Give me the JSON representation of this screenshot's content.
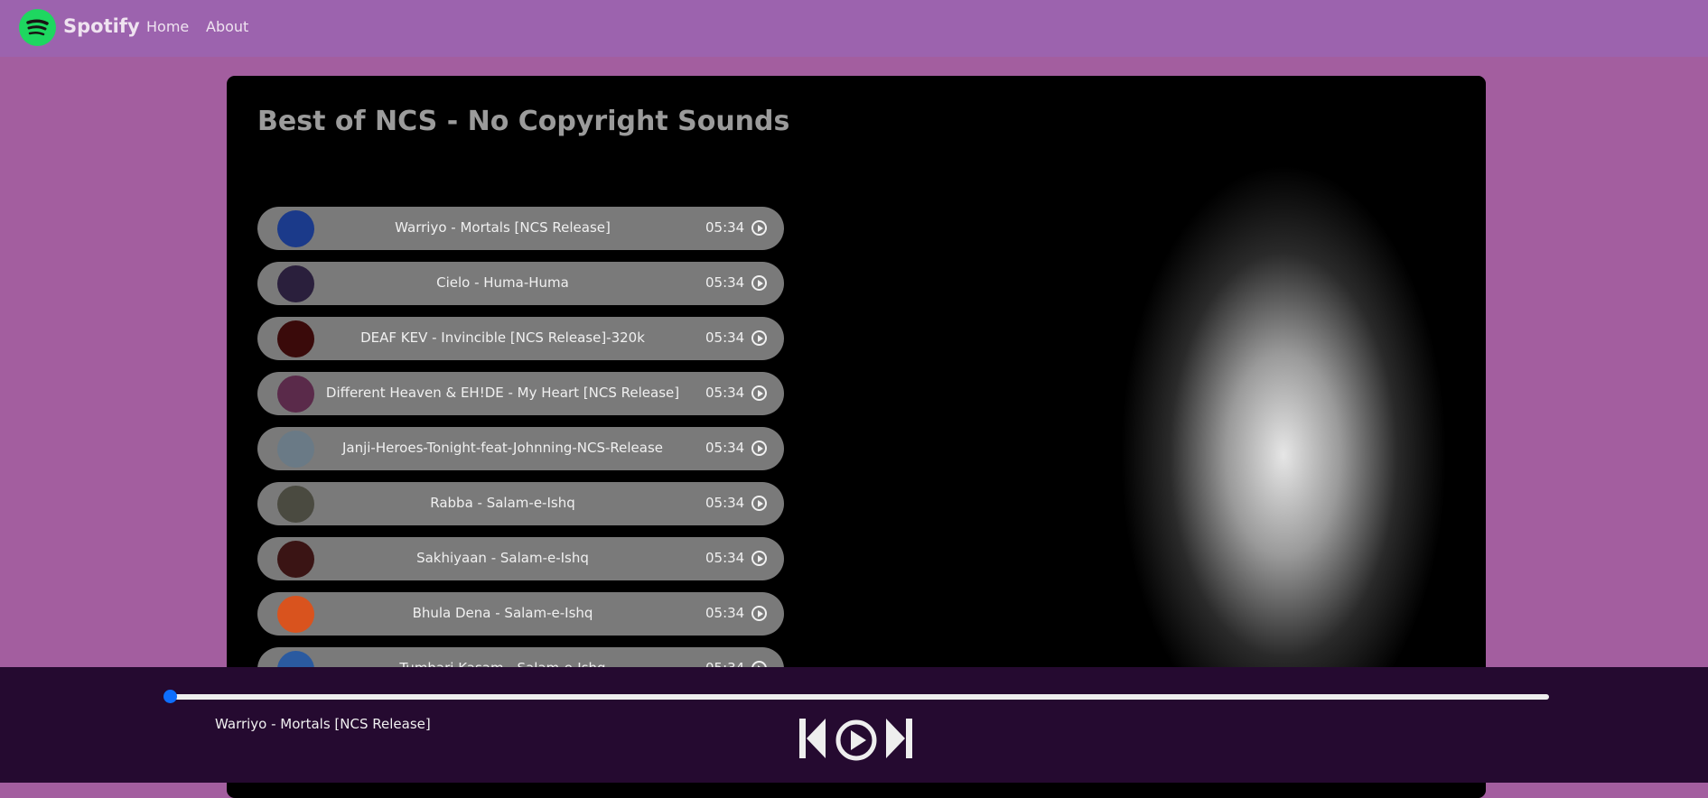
{
  "nav": {
    "brand": "Spotify",
    "links": [
      "Home",
      "About"
    ]
  },
  "playlist": {
    "title": "Best of NCS - No Copyright Sounds",
    "songs": [
      {
        "name": "Warriyo - Mortals [NCS Release]",
        "duration": "05:34",
        "thumb_color": "#1b3a8a"
      },
      {
        "name": "Cielo - Huma-Huma",
        "duration": "05:34",
        "thumb_color": "#2a1f3c"
      },
      {
        "name": "DEAF KEV - Invincible [NCS Release]-320k",
        "duration": "05:34",
        "thumb_color": "#3a0a0a"
      },
      {
        "name": "Different Heaven & EH!DE - My Heart [NCS Release]",
        "duration": "05:34",
        "thumb_color": "#5a2a4a"
      },
      {
        "name": "Janji-Heroes-Tonight-feat-Johnning-NCS-Release",
        "duration": "05:34",
        "thumb_color": "#6a7a86"
      },
      {
        "name": "Rabba - Salam-e-Ishq",
        "duration": "05:34",
        "thumb_color": "#4a4a40"
      },
      {
        "name": "Sakhiyaan - Salam-e-Ishq",
        "duration": "05:34",
        "thumb_color": "#3a1414"
      },
      {
        "name": "Bhula Dena - Salam-e-Ishq",
        "duration": "05:34",
        "thumb_color": "#d9531e"
      },
      {
        "name": "Tumhari Kasam - Salam-e-Ishq",
        "duration": "05:34",
        "thumb_color": "#2a5aa0"
      }
    ]
  },
  "player": {
    "now_playing": "Warriyo - Mortals [NCS Release]",
    "progress_percent": 0,
    "accent": "#0d6efd"
  }
}
